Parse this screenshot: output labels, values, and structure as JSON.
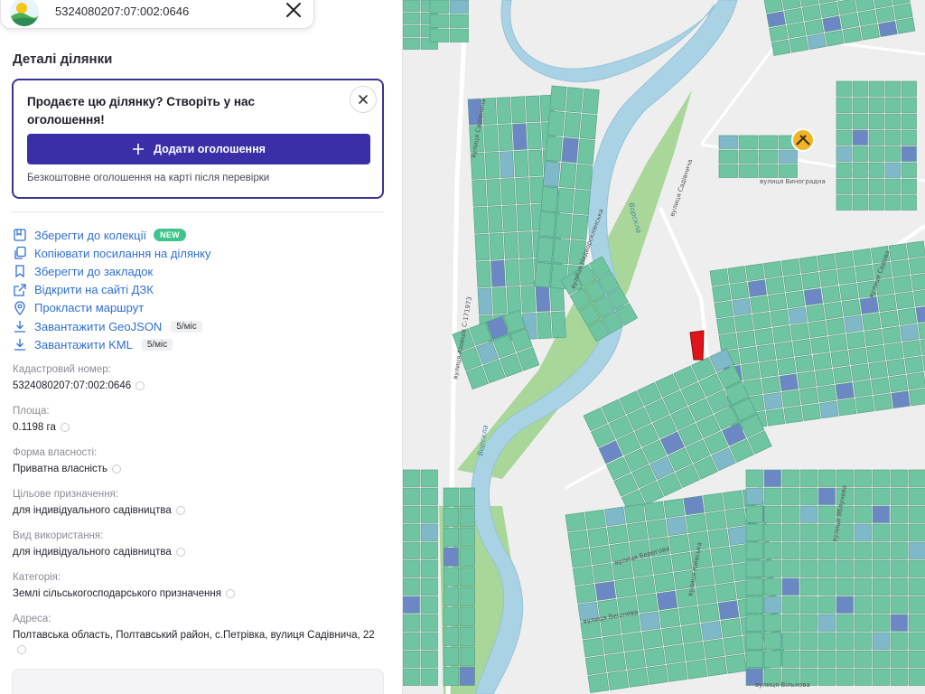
{
  "search": {
    "value": "5324080207:07:002:0646"
  },
  "panel": {
    "title": "Деталі ділянки",
    "promo": {
      "text": "Продаєте цю ділянку? Створіть у нас оголошення!",
      "button": "Додати оголошення",
      "note": "Безкоштовне оголошення на карті після перевірки"
    },
    "actions": [
      {
        "label": "Зберегти до колекції",
        "icon": "collection-icon",
        "badge": "NEW"
      },
      {
        "label": "Копіювати посилання на ділянку",
        "icon": "link-icon"
      },
      {
        "label": "Зберегти до закладок",
        "icon": "bookmark-icon"
      },
      {
        "label": "Відкрити на сайті ДЗК",
        "icon": "external-link-icon"
      },
      {
        "label": "Прокласти маршрут",
        "icon": "location-pin-icon"
      },
      {
        "label": "Завантажити GeoJSON",
        "icon": "download-icon",
        "price": "5/міс"
      },
      {
        "label": "Завантажити KML",
        "icon": "download-icon",
        "price": "5/міс"
      }
    ],
    "info": [
      {
        "label": "Кадастровий номер:",
        "value": "5324080207:07:002:0646"
      },
      {
        "label": "Площа:",
        "value": "0.1198 га"
      },
      {
        "label": "Форма власності:",
        "value": "Приватна власність"
      },
      {
        "label": "Цільове призначення:",
        "value": "для індивідуального садівництва"
      },
      {
        "label": "Вид використання:",
        "value": "для індивідуального садівництва"
      },
      {
        "label": "Категорія:",
        "value": "Землі сільськогосподарського призначення"
      },
      {
        "label": "Адреса:",
        "value": "Полтавська область, Полтавський район, с.Петрівка, вулиця Садівнича, 22"
      }
    ]
  },
  "map": {
    "labels": {
      "river": "Ворскла",
      "river2": "Ворскла",
      "sadivnycha": "вулиця Садівнича",
      "sadivnycha2": "вулиця Садівнича",
      "azovtsi": "вулиця Азовців С-171973",
      "nadvorskliansk": "вулиця Надворсклянська",
      "vynohradna": "вулиця Виноградна",
      "sadova": "вулиця Садова",
      "berehova": "вулиця Берегова",
      "vyshneva": "вулиця Вишнева",
      "kyivska": "вулиця Київська",
      "vilkhova": "вулиця Вільхова",
      "yablunev": "вулиця Яблунева"
    },
    "colors": {
      "parcel": "#6fc4a1",
      "parcel_alt": "#7fb8c8",
      "parcel_blue": "#6b88c4",
      "selected": "#e0151b",
      "park": "#a9d79a",
      "river": "#a9d3e4"
    }
  }
}
